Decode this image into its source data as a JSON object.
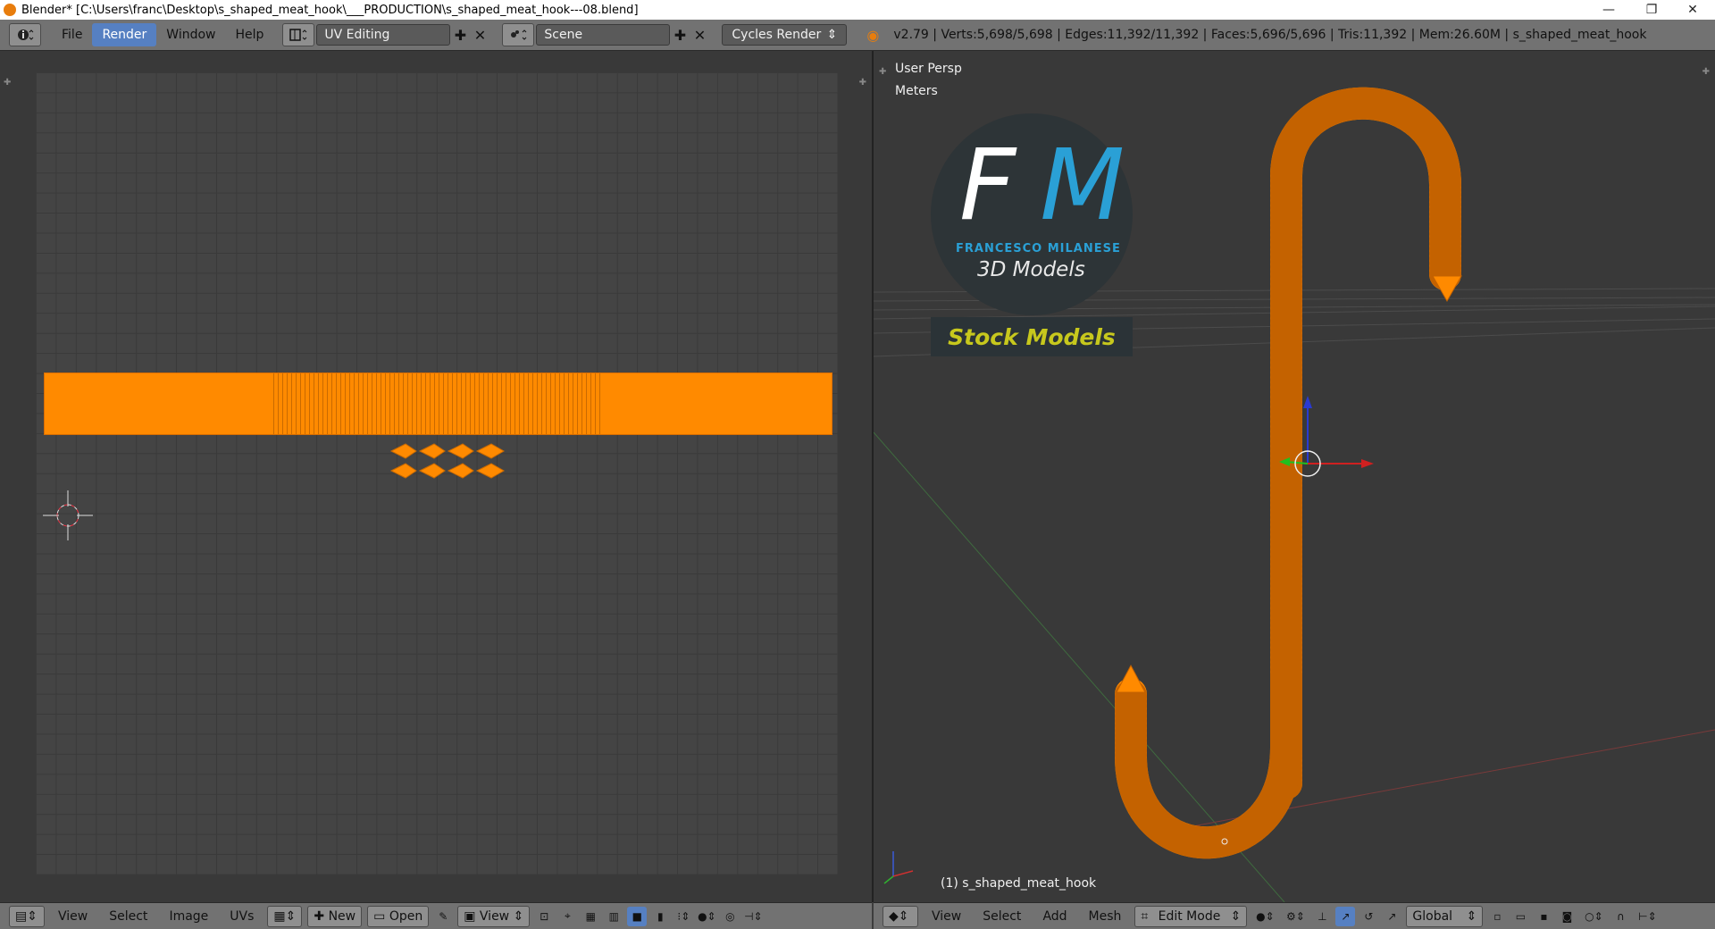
{
  "window": {
    "title": "Blender* [C:\\Users\\franc\\Desktop\\s_shaped_meat_hook\\___PRODUCTION\\s_shaped_meat_hook---08.blend]",
    "controls": [
      "—",
      "❐",
      "✕"
    ]
  },
  "topbar": {
    "menus": [
      "File",
      "Render",
      "Window",
      "Help"
    ],
    "active_menu": "Render",
    "layout": "UV Editing",
    "scene": "Scene",
    "engine": "Cycles Render",
    "stats": "v2.79 | Verts:5,698/5,698 | Edges:11,392/11,392 | Faces:5,696/5,696 | Tris:11,392 | Mem:26.60M | s_shaped_meat_hook"
  },
  "viewport": {
    "view_name": "User Persp",
    "units": "Meters",
    "object_label": "(1) s_shaped_meat_hook",
    "watermark": {
      "initials": "FM",
      "name": "FRANCESCO MILANESE",
      "subtitle": "3D Models",
      "banner": "Stock Models"
    }
  },
  "uv_footer": {
    "menus": [
      "View",
      "Select",
      "Image",
      "UVs"
    ],
    "new_label": "New",
    "open_label": "Open",
    "view_label": "View"
  },
  "vp_footer": {
    "menus": [
      "View",
      "Select",
      "Add",
      "Mesh"
    ],
    "mode": "Edit Mode",
    "orientation": "Global"
  },
  "colors": {
    "accent": "#5680c2",
    "mesh": "#ff8a00",
    "watermark_blue": "#2aa0d6",
    "banner_yellow": "#c7c81d"
  }
}
